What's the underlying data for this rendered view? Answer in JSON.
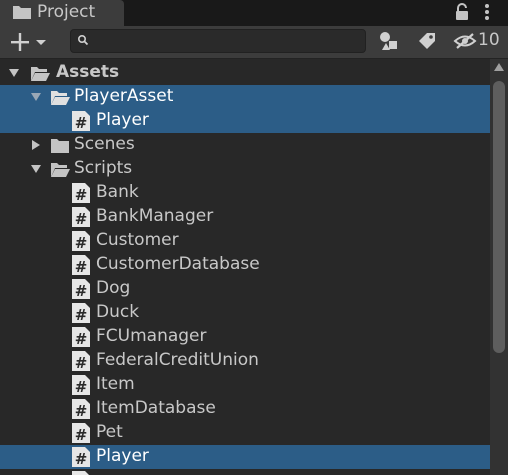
{
  "tab": {
    "title": "Project"
  },
  "toolbar": {
    "add_label": "+",
    "search_value": "",
    "hidden_count": "10"
  },
  "tree": {
    "items": [
      {
        "label": "Assets"
      },
      {
        "label": "PlayerAsset"
      },
      {
        "label": "Player"
      },
      {
        "label": "Scenes"
      },
      {
        "label": "Scripts"
      },
      {
        "label": "Bank"
      },
      {
        "label": "BankManager"
      },
      {
        "label": "Customer"
      },
      {
        "label": "CustomerDatabase"
      },
      {
        "label": "Dog"
      },
      {
        "label": "Duck"
      },
      {
        "label": "FCUmanager"
      },
      {
        "label": "FederalCreditUnion"
      },
      {
        "label": "Item"
      },
      {
        "label": "ItemDatabase"
      },
      {
        "label": "Pet"
      },
      {
        "label": "Player"
      }
    ]
  },
  "colors": {
    "selection": "#2c5d87",
    "panel": "#282828",
    "toolbar": "#3c3c3c"
  }
}
